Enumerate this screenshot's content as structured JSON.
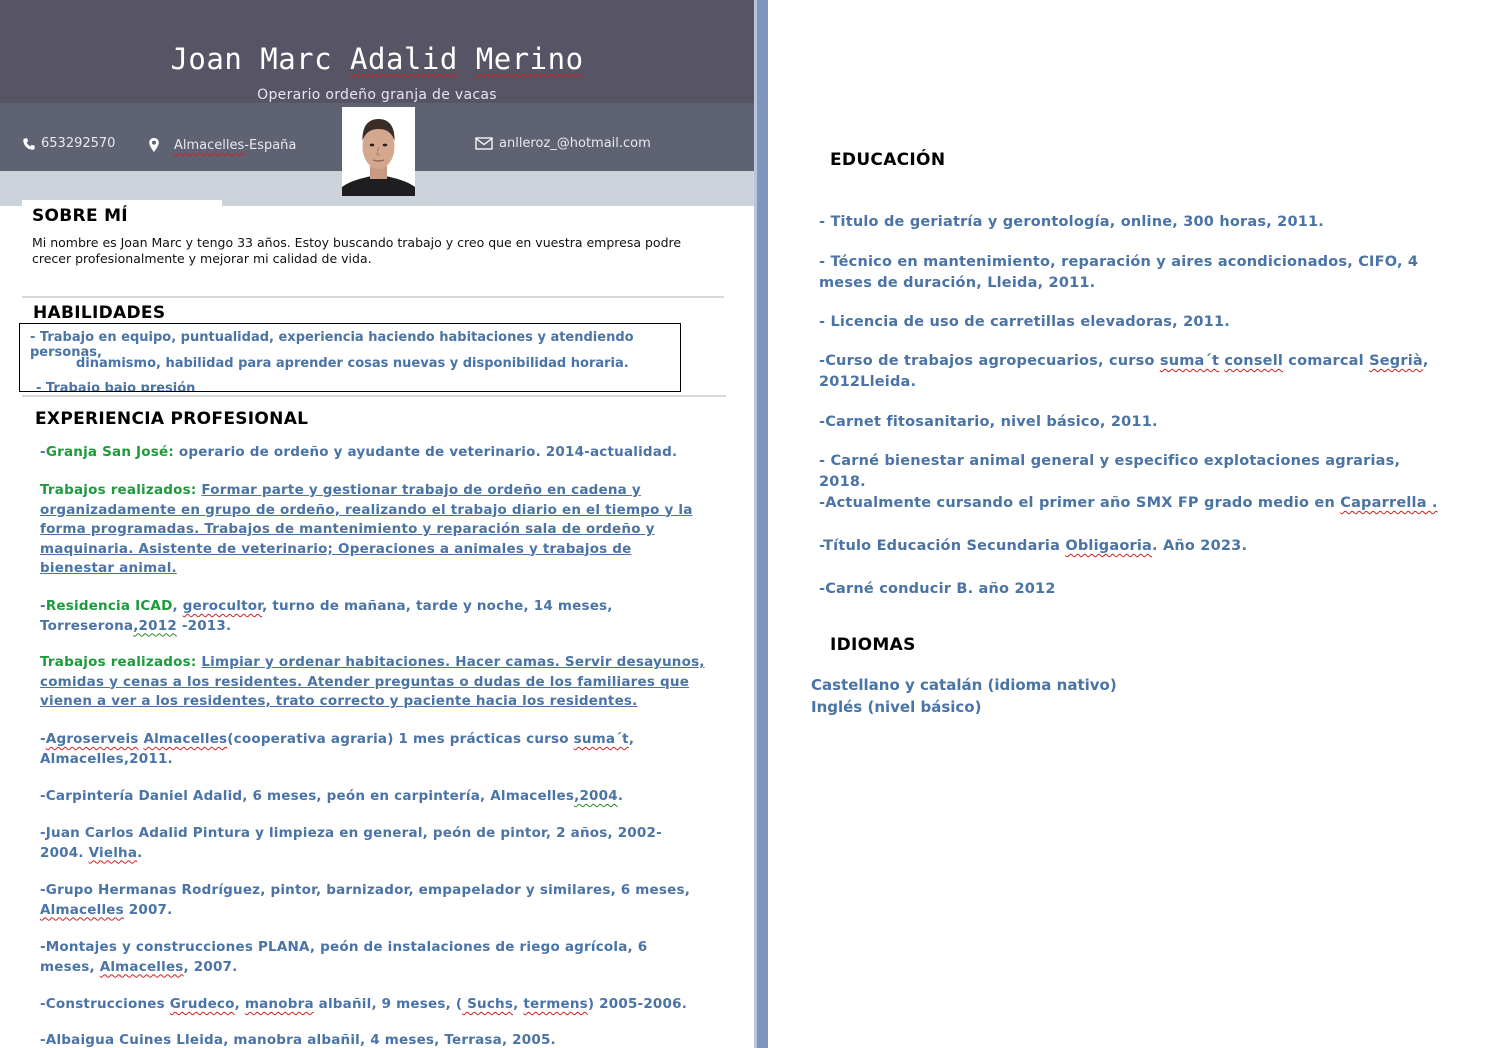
{
  "header": {
    "name_part1": "Joan Marc ",
    "name_part2": "Adalid",
    "name_part3": " ",
    "name_part4": "Merino",
    "subtitle": "Operario ordeño granja de vacas"
  },
  "contact": {
    "phone": "653292570",
    "phone_icon": "phone-icon",
    "location_part1": "Almacelles",
    "location_part2": "-España",
    "location_icon": "map-pin-icon",
    "email": "anlleroz_@hotmail.com",
    "email_icon": "envelope-icon"
  },
  "photo": {
    "alt": "profile photo"
  },
  "sobre_mi": {
    "title": "SOBRE MÍ",
    "line1": "Mi nombre es Joan Marc y tengo 33 años. Estoy buscando trabajo y creo que en vuestra empresa podre",
    "line2": "crecer profesionalmente y mejorar mi calidad de vida."
  },
  "habilidades": {
    "title": "HABILIDADES",
    "line1": "- Trabajo en equipo, puntualidad, experiencia haciendo habitaciones y atendiendo personas,",
    "line2": "dinamismo, habilidad para aprender cosas nuevas y disponibilidad horaria.",
    "line3": "- Trabajo bajo presión"
  },
  "experiencia": {
    "title": "EXPERIENCIA PROFESIONAL",
    "e1_a": "-",
    "e1_b": "Granja San José:",
    "e1_c": " operario de ordeño  y ayudante de veterinario. 2014-actualidad.",
    "e2_label": "Trabajos realizados:",
    "e2_space": " ",
    "e2_text": "Formar parte y gestionar trabajo de ordeño en cadena y organizadamente en grupo de ordeño, realizando el trabajo diario en el tiempo y la forma programadas. Trabajos de mantenimiento y reparación sala de ordeño y maquinaria. Asistente de veterinario; Operaciones a animales y trabajos de bienestar animal.",
    "e3_a": "-",
    "e3_b": "Residencia ICAD",
    "e3_c": ", ",
    "e3_d": "gerocultor",
    "e3_e": ", turno de mañana, tarde y noche, 14 meses, Torreserona",
    "e3_f": ",2012",
    "e3_g": " -2013.",
    "e4_label": "Trabajos realizados:",
    "e4_space": " ",
    "e4_text": "Limpiar y ordenar  habitaciones. Hacer camas. Servir desayunos, comidas y cenas a los residentes. Atender preguntas  o dudas  de los familiares que vienen a ver a los residentes, trato correcto y paciente hacia los residentes.",
    "e5_a": "-",
    "e5_b": "Agroserveis",
    "e5_c": " ",
    "e5_d": "Almacelles",
    "e5_e": "(cooperativa agraria) 1 mes prácticas curso ",
    "e5_f": "suma´t",
    "e5_g": ", Almacelles,2011.",
    "e6_a": "-Carpintería Daniel Adalid, 6 meses, peón en carpintería,  Almacelles",
    "e6_b": ",2004",
    "e6_c": ".",
    "e7_a": "-Juan Carlos Adalid Pintura y limpieza en general, peón de pintor, 2 años, 2002-2004. ",
    "e7_b": "Vielha",
    "e7_c": ".",
    "e8_a": "-Grupo Hermanas Rodríguez, pintor, barnizador, empapelador y similares, 6 meses, ",
    "e8_b": "Almacelles",
    "e8_c": " 2007.",
    "e9_a": "-Montajes y construcciones PLANA, peón de instalaciones de riego agrícola, 6 meses, ",
    "e9_b": "Almacelles",
    "e9_c": ", 2007.",
    "e10_a": "-Construcciones ",
    "e10_b": "Grudeco",
    "e10_c": ",  ",
    "e10_d": "manobra",
    "e10_e": " albañil, 9 meses, (",
    "e10_f": " Suchs",
    "e10_g": ", ",
    "e10_h": "termens",
    "e10_i": ") 2005-2006.",
    "e11": "-Albaigua Cuines Lleida, manobra albañil, 4 meses, Terrasa, 2005."
  },
  "educacion": {
    "title": "EDUCACIÓN",
    "i1": "- Titulo de geriatría y gerontología, online, 300 horas, 2011.",
    "i2": "- Técnico en mantenimiento, reparación y aires acondicionados, CIFO, 4 meses de duración, Lleida, 2011.",
    "i3": "- Licencia de uso de carretillas elevadoras, 2011.",
    "i4_a": "-Curso de trabajos agropecuarios, curso ",
    "i4_b": "suma´t",
    "i4_c": " ",
    "i4_d": "consell",
    "i4_e": " comarcal ",
    "i4_f": "Segrià",
    "i4_g": ", 2012Lleida.",
    "i5": "-Carnet fitosanitario, nivel básico, 2011.",
    "i6": "- Carné bienestar animal general y especifico explotaciones agrarias, 2018.",
    "i7_a": "-Actualmente cursando el primer año SMX FP grado medio en ",
    "i7_b": "Caparrella .",
    "i8_a": "-Título Educación Secundaria ",
    "i8_b": "Obligaoria",
    "i8_c": ". Año 2023.",
    "i9": "-Carné conducir B. año 2012"
  },
  "idiomas": {
    "title": "IDIOMAS",
    "l1": "Castellano y catalán (idioma nativo)",
    "l2": "Inglés (nivel básico)"
  },
  "colors": {
    "header_dark": "#575565",
    "contact_bar": "#5e6273",
    "accent_blue": "#4a73a6",
    "accent_green": "#1d9a3c",
    "gap_blue": "#7f97bd"
  }
}
